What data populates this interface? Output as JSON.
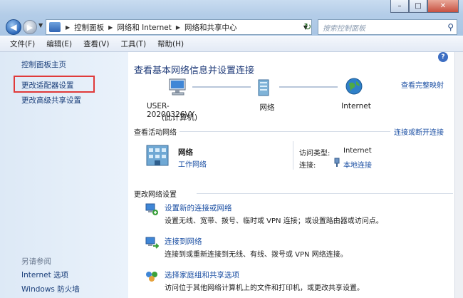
{
  "window": {
    "controls": {
      "minimize": "–",
      "maximize": "□",
      "close": "✕"
    }
  },
  "address": {
    "crumbs": [
      "控制面板",
      "网络和 Internet",
      "网络和共享中心"
    ],
    "search_placeholder": "搜索控制面板"
  },
  "menu": [
    "文件(F)",
    "编辑(E)",
    "查看(V)",
    "工具(T)",
    "帮助(H)"
  ],
  "sidebar": {
    "home": "控制面板主页",
    "adapter_settings": "更改适配器设置",
    "sharing_settings": "更改高级共享设置",
    "see_also": "另请参阅",
    "internet_options": "Internet 选项",
    "firewall": "Windows 防火墙"
  },
  "main": {
    "title": "查看基本网络信息并设置连接",
    "full_map": "查看完整映射",
    "map": {
      "computer_name": "USER-20200326VY",
      "computer_sub": "(此计算机)",
      "network": "网络",
      "internet": "Internet"
    },
    "active_networks": {
      "header": "查看活动网络",
      "connect_link": "连接或断开连接",
      "name": "网络",
      "type": "工作网络",
      "access_label": "访问类型:",
      "access_value": "Internet",
      "connections_label": "连接:",
      "connections_value": "本地连接"
    },
    "change_settings": {
      "header": "更改网络设置",
      "tasks": [
        {
          "link": "设置新的连接或网络",
          "desc": "设置无线、宽带、拨号、临时或 VPN 连接；或设置路由器或访问点。"
        },
        {
          "link": "连接到网络",
          "desc": "连接到或重新连接到无线、有线、拨号或 VPN 网络连接。"
        },
        {
          "link": "选择家庭组和共享选项",
          "desc": "访问位于其他网络计算机上的文件和打印机，或更改共享设置。"
        }
      ]
    }
  },
  "colors": {
    "link": "#1b4fa3",
    "highlight_box": "#e03a3a",
    "title": "#1e3a78"
  }
}
